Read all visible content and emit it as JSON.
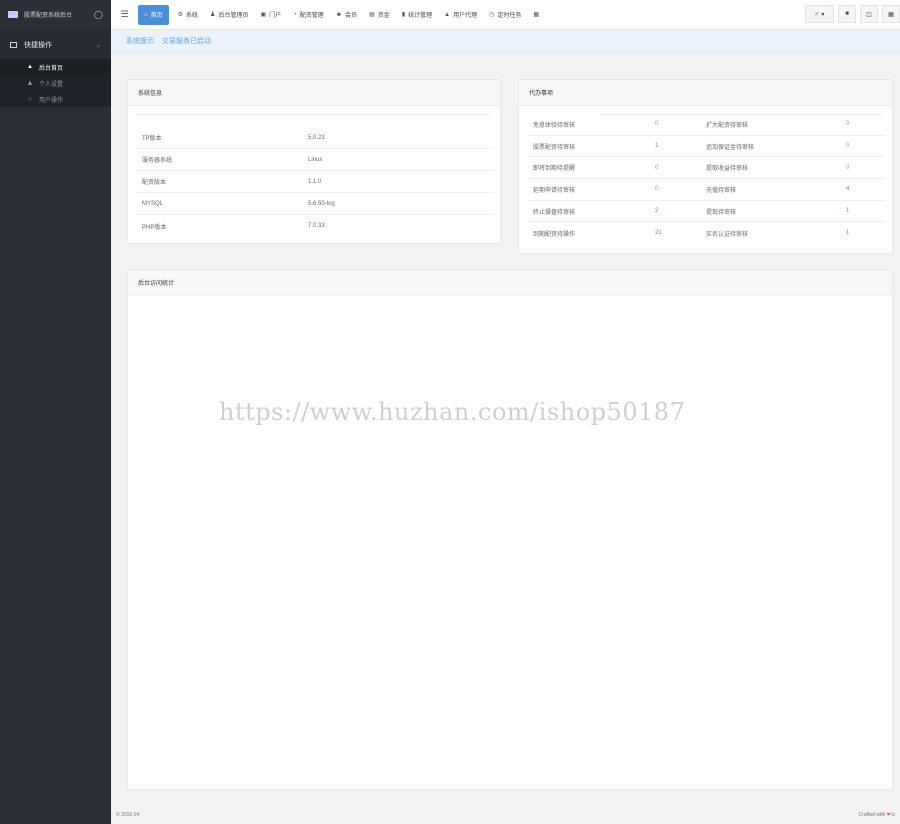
{
  "sidebar": {
    "brand": "股票配资系统后台",
    "brand_icon": "drop-icon",
    "group": {
      "label": "快捷操作",
      "icon": "folder-icon",
      "chevron": "chevron-down-icon"
    },
    "items": [
      {
        "label": "后台首页",
        "icon": "home-icon",
        "active": true
      },
      {
        "label": "个人设置",
        "icon": "user-icon",
        "active": false
      },
      {
        "label": "用户操作",
        "icon": "star-icon",
        "active": false
      }
    ]
  },
  "topnav": {
    "menu_icon": "menu-icon",
    "items": [
      {
        "label": "首页",
        "icon": "home-icon"
      },
      {
        "label": "系统",
        "icon": "gear-icon"
      },
      {
        "label": "后台管理员",
        "icon": "user-icon"
      },
      {
        "label": "门户",
        "icon": "portal-icon"
      },
      {
        "label": "配资管理",
        "icon": "pie-icon"
      },
      {
        "label": "会员",
        "icon": "users-icon"
      },
      {
        "label": "资金",
        "icon": "money-icon"
      },
      {
        "label": "统计管理",
        "icon": "bar-chart-icon"
      },
      {
        "label": "用户代理",
        "icon": "sitemap-icon"
      },
      {
        "label": "定时任务",
        "icon": "clock-icon"
      },
      {
        "label": "",
        "icon": "table-icon"
      }
    ],
    "right_buttons": [
      "brush-icon",
      "trash-icon",
      "external-icon",
      "grid-icon"
    ]
  },
  "notice": {
    "label": "系统提示",
    "message": "交易服务已启动"
  },
  "system_info": {
    "title": "系统信息",
    "rows": [
      {
        "key": "TP版本",
        "value": "5.0.23"
      },
      {
        "key": "服务器系统",
        "value": "Linux"
      },
      {
        "key": "配资版本",
        "value": "1.1.0"
      },
      {
        "key": "MYSQL",
        "value": "5.6.50-log"
      },
      {
        "key": "PHP版本",
        "value": "7.0.33"
      }
    ]
  },
  "todo": {
    "title": "代办事项",
    "rows": [
      {
        "k1": "免息体验待审核",
        "v1": "0",
        "k2": "扩大配资待审核",
        "v2": "0"
      },
      {
        "k1": "股票配资待审核",
        "v1": "1",
        "k2": "追加保证金待审核",
        "v2": "0"
      },
      {
        "k1": "即将到期待提醒",
        "v1": "0",
        "k2": "提取收益待审核",
        "v2": "0"
      },
      {
        "k1": "延期申请待审核",
        "v1": "0",
        "k2": "充值待审核",
        "v2": "4"
      },
      {
        "k1": "终止操盘待审核",
        "v1": "2",
        "k2": "提现待审核",
        "v2": "1"
      },
      {
        "k1": "到期配资待操作",
        "v1": "21",
        "k2": "实名认证待审核",
        "v2": "1"
      }
    ]
  },
  "stats": {
    "title": "后台访问统计"
  },
  "watermark": "https://www.huzhan.com/ishop50187",
  "footer": {
    "left": "© 2015-24",
    "right_prefix": "Crafted with",
    "right_suffix": "b"
  }
}
